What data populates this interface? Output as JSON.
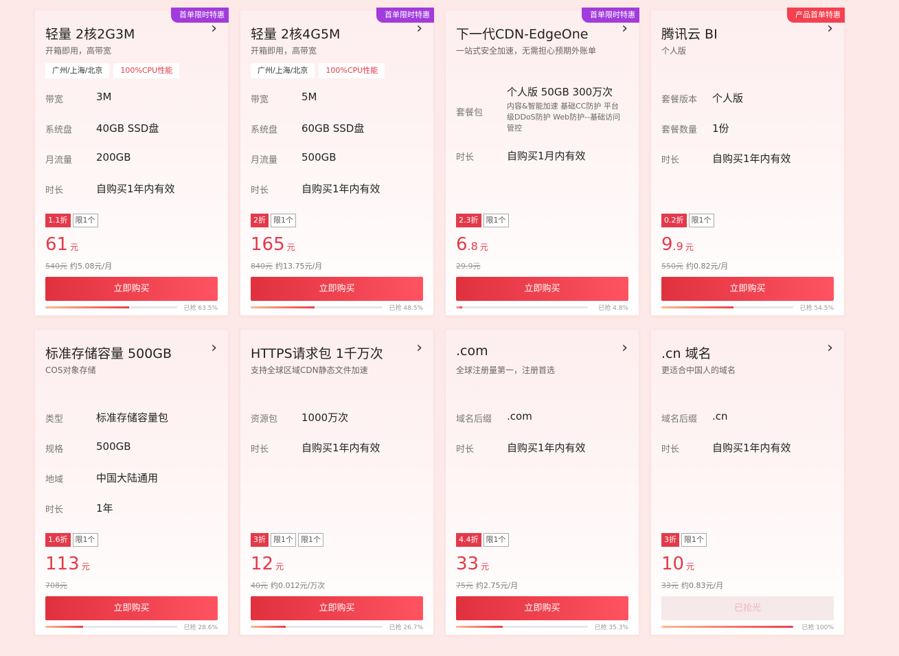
{
  "colors": {
    "badge_purple": "#a23bdb",
    "badge_red": "#f4404f",
    "accent": "#e23a4a"
  },
  "cards": [
    {
      "badge": "首单限时特惠",
      "badge_color": "purple",
      "title": "轻量 2核2G3M",
      "subtitle": "开箱即用，高带宽",
      "tags": [
        "广州/上海/北京",
        "100%CPU性能"
      ],
      "specs": [
        {
          "k": "带宽",
          "v": "3M"
        },
        {
          "k": "系统盘",
          "v": "40GB SSD盘"
        },
        {
          "k": "月流量",
          "v": "200GB"
        },
        {
          "k": "时长",
          "v": "自购买1年内有效"
        }
      ],
      "discount": "1.1折",
      "limits": [
        "限1个"
      ],
      "price_int": "61",
      "price_dec": "",
      "unit": "元",
      "original": "540元",
      "monthly": "约5.08元/月",
      "button": "立即购买",
      "progress_label": "已抢 63.5%",
      "progress": 63.5
    },
    {
      "badge": "首单限时特惠",
      "badge_color": "purple",
      "title": "轻量 2核4G5M",
      "subtitle": "开箱即用，高带宽",
      "tags": [
        "广州/上海/北京",
        "100%CPU性能"
      ],
      "specs": [
        {
          "k": "带宽",
          "v": "5M"
        },
        {
          "k": "系统盘",
          "v": "60GB SSD盘"
        },
        {
          "k": "月流量",
          "v": "500GB"
        },
        {
          "k": "时长",
          "v": "自购买1年内有效"
        }
      ],
      "discount": "2折",
      "limits": [
        "限1个"
      ],
      "price_int": "165",
      "price_dec": "",
      "unit": "元",
      "original": "840元",
      "monthly": "约13.75元/月",
      "button": "立即购买",
      "progress_label": "已抢 48.5%",
      "progress": 48.5
    },
    {
      "badge": "首单限时特惠",
      "badge_color": "purple",
      "title": "下一代CDN-EdgeOne",
      "subtitle": "一站式安全加速，无需担心预期外账单",
      "tags": [],
      "package": {
        "k": "套餐包",
        "v": "个人版 50GB 300万次",
        "desc": "内容&智能加速 基础CC防护 平台级DDoS防护 Web防护--基础访问管控"
      },
      "specs": [
        {
          "k": "时长",
          "v": "自购买1月内有效"
        }
      ],
      "discount": "2.3折",
      "limits": [
        "限1个"
      ],
      "price_int": "6",
      "price_dec": ".8",
      "unit": "元",
      "original": "29.9元",
      "monthly": "",
      "button": "立即购买",
      "progress_label": "已抢 4.8%",
      "progress": 4.8
    },
    {
      "badge": "产品首单特惠",
      "badge_color": "red",
      "title": "腾讯云 BI",
      "subtitle": "个人版",
      "tags": [],
      "specs": [
        {
          "k": "套餐版本",
          "v": "个人版"
        },
        {
          "k": "套餐数量",
          "v": "1份"
        },
        {
          "k": "时长",
          "v": "自购买1年内有效"
        }
      ],
      "discount": "0.2折",
      "limits": [
        "限1个"
      ],
      "price_int": "9",
      "price_dec": ".9",
      "unit": "元",
      "original": "550元",
      "monthly": "约0.82元/月",
      "button": "立即购买",
      "progress_label": "已抢 54.5%",
      "progress": 54.5
    },
    {
      "badge": "",
      "badge_color": "",
      "title": "标准存储容量 500GB",
      "subtitle": "COS对象存储",
      "tags": [],
      "specs": [
        {
          "k": "类型",
          "v": "标准存储容量包"
        },
        {
          "k": "规格",
          "v": "500GB"
        },
        {
          "k": "地域",
          "v": "中国大陆通用"
        },
        {
          "k": "时长",
          "v": "1年"
        }
      ],
      "discount": "1.6折",
      "limits": [
        "限1个"
      ],
      "price_int": "113",
      "price_dec": "",
      "unit": "元",
      "original": "708元",
      "monthly": "",
      "button": "立即购买",
      "progress_label": "已抢 28.6%",
      "progress": 28.6
    },
    {
      "badge": "",
      "badge_color": "",
      "title": "HTTPS请求包 1千万次",
      "subtitle": "支持全球区域CDN静态文件加速",
      "tags": [],
      "specs": [
        {
          "k": "资源包",
          "v": "1000万次"
        },
        {
          "k": "时长",
          "v": "自购买1年内有效"
        }
      ],
      "discount": "3折",
      "limits": [
        "限1个",
        "限1个"
      ],
      "price_int": "12",
      "price_dec": "",
      "unit": "元",
      "original": "40元",
      "monthly": "约0.012元/万次",
      "button": "立即购买",
      "progress_label": "已抢 26.7%",
      "progress": 26.7
    },
    {
      "badge": "",
      "badge_color": "",
      "title": ".com",
      "subtitle": "全球注册量第一，注册首选",
      "tags": [],
      "specs": [
        {
          "k": "域名后缀",
          "v": ".com"
        },
        {
          "k": "时长",
          "v": "自购买1年内有效"
        }
      ],
      "discount": "4.4折",
      "limits": [
        "限1个"
      ],
      "price_int": "33",
      "price_dec": "",
      "unit": "元",
      "original": "75元",
      "monthly": "约2.75元/月",
      "button": "立即购买",
      "progress_label": "已抢 35.3%",
      "progress": 35.3
    },
    {
      "badge": "",
      "badge_color": "",
      "title": ".cn 域名",
      "subtitle": "更适合中国人的域名",
      "tags": [],
      "specs": [
        {
          "k": "域名后缀",
          "v": ".cn"
        },
        {
          "k": "时长",
          "v": "自购买1年内有效"
        }
      ],
      "discount": "3折",
      "limits": [
        "限1个"
      ],
      "price_int": "10",
      "price_dec": "",
      "unit": "元",
      "original": "33元",
      "monthly": "约0.83元/月",
      "button": "已抢光",
      "sold_out": true,
      "progress_label": "已抢 100%",
      "progress": 100
    }
  ]
}
